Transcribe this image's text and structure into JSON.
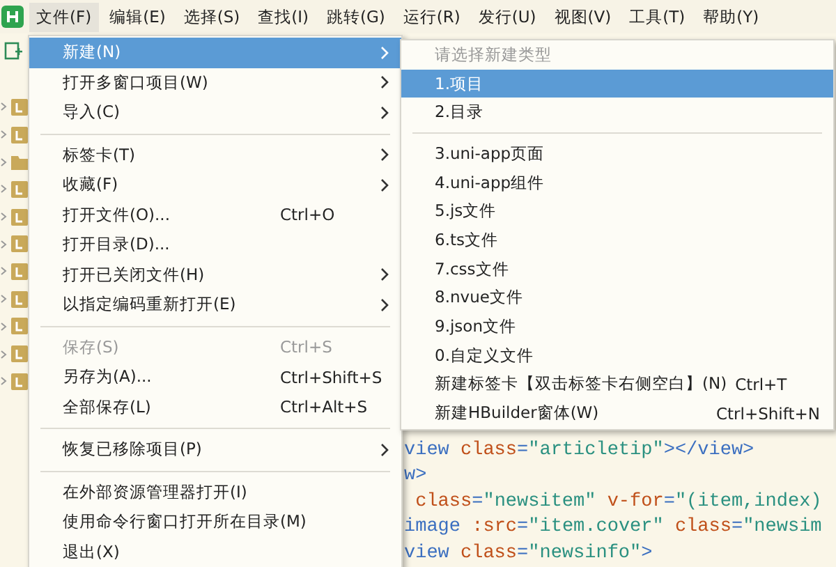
{
  "menubar": {
    "items": [
      {
        "label": "文件(F)",
        "selected": true
      },
      {
        "label": "编辑(E)",
        "selected": false
      },
      {
        "label": "选择(S)",
        "selected": false
      },
      {
        "label": "查找(I)",
        "selected": false
      },
      {
        "label": "跳转(G)",
        "selected": false
      },
      {
        "label": "运行(R)",
        "selected": false
      },
      {
        "label": "发行(U)",
        "selected": false
      },
      {
        "label": "视图(V)",
        "selected": false
      },
      {
        "label": "工具(T)",
        "selected": false
      },
      {
        "label": "帮助(Y)",
        "selected": false
      }
    ]
  },
  "sidebar": {
    "rows": [
      {
        "kind": "project"
      },
      {
        "kind": "project"
      },
      {
        "kind": "folder"
      },
      {
        "kind": "project"
      },
      {
        "kind": "project"
      },
      {
        "kind": "project"
      },
      {
        "kind": "project"
      },
      {
        "kind": "project"
      },
      {
        "kind": "project"
      },
      {
        "kind": "project"
      },
      {
        "kind": "project"
      }
    ]
  },
  "editor": {
    "lines": [
      [
        {
          "kind": "tag",
          "text": "view"
        },
        {
          "kind": "attr",
          "text": " class"
        },
        {
          "kind": "tag",
          "text": "="
        },
        {
          "kind": "string",
          "text": "\"articletip\""
        },
        {
          "kind": "tag",
          "text": "></view>"
        }
      ],
      [
        {
          "kind": "tag",
          "text": "w>"
        }
      ],
      [
        {
          "kind": "attr",
          "text": " class"
        },
        {
          "kind": "tag",
          "text": "="
        },
        {
          "kind": "string",
          "text": "\"newsitem\""
        },
        {
          "kind": "attr",
          "text": " v-for"
        },
        {
          "kind": "tag",
          "text": "="
        },
        {
          "kind": "string",
          "text": "\"(item,index)"
        }
      ],
      [
        {
          "kind": "tag",
          "text": "image"
        },
        {
          "kind": "attr",
          "text": " :src"
        },
        {
          "kind": "tag",
          "text": "="
        },
        {
          "kind": "string",
          "text": "\"item.cover\""
        },
        {
          "kind": "attr",
          "text": " class"
        },
        {
          "kind": "tag",
          "text": "="
        },
        {
          "kind": "string",
          "text": "\"newsim"
        }
      ],
      [
        {
          "kind": "tag",
          "text": "view"
        },
        {
          "kind": "attr",
          "text": " class"
        },
        {
          "kind": "tag",
          "text": "="
        },
        {
          "kind": "string",
          "text": "\"newsinfo\""
        },
        {
          "kind": "tag",
          "text": ">"
        }
      ]
    ]
  },
  "file_menu": {
    "groups": [
      [
        {
          "label": "新建(N)",
          "has_submenu": true,
          "disabled": false,
          "selected": true
        },
        {
          "label": "打开多窗口项目(W)",
          "has_submenu": true,
          "disabled": false,
          "selected": false
        },
        {
          "label": "导入(C)",
          "has_submenu": true,
          "disabled": false,
          "selected": false
        }
      ],
      [
        {
          "label": "标签卡(T)",
          "has_submenu": true,
          "disabled": false,
          "selected": false
        },
        {
          "label": "收藏(F)",
          "has_submenu": true,
          "disabled": false,
          "selected": false
        },
        {
          "label": "打开文件(O)...",
          "shortcut": "Ctrl+O",
          "has_submenu": false,
          "disabled": false,
          "selected": false
        },
        {
          "label": "打开目录(D)...",
          "has_submenu": false,
          "disabled": false,
          "selected": false
        },
        {
          "label": "打开已关闭文件(H)",
          "has_submenu": true,
          "disabled": false,
          "selected": false
        },
        {
          "label": "以指定编码重新打开(E)",
          "has_submenu": true,
          "disabled": false,
          "selected": false
        }
      ],
      [
        {
          "label": "保存(S)",
          "shortcut": "Ctrl+S",
          "has_submenu": false,
          "disabled": true,
          "selected": false
        },
        {
          "label": "另存为(A)...",
          "shortcut": "Ctrl+Shift+S",
          "has_submenu": false,
          "disabled": false,
          "selected": false
        },
        {
          "label": "全部保存(L)",
          "shortcut": "Ctrl+Alt+S",
          "has_submenu": false,
          "disabled": false,
          "selected": false
        }
      ],
      [
        {
          "label": "恢复已移除项目(P)",
          "has_submenu": true,
          "disabled": false,
          "selected": false
        }
      ],
      [
        {
          "label": "在外部资源管理器打开(I)",
          "has_submenu": false,
          "disabled": false,
          "selected": false
        },
        {
          "label": "使用命令行窗口打开所在目录(M)",
          "has_submenu": false,
          "disabled": false,
          "selected": false
        },
        {
          "label": "退出(X)",
          "has_submenu": false,
          "disabled": false,
          "selected": false
        }
      ]
    ]
  },
  "new_submenu": {
    "header": "请选择新建类型",
    "groups": [
      [
        {
          "label": "1.项目",
          "selected": true
        },
        {
          "label": "2.目录",
          "selected": false
        }
      ],
      [
        {
          "label": "3.uni-app页面",
          "selected": false
        },
        {
          "label": "4.uni-app组件",
          "selected": false
        },
        {
          "label": "5.js文件",
          "selected": false
        },
        {
          "label": "6.ts文件",
          "selected": false
        },
        {
          "label": "7.css文件",
          "selected": false
        },
        {
          "label": "8.nvue文件",
          "selected": false
        },
        {
          "label": "9.json文件",
          "selected": false
        },
        {
          "label": "0.自定义文件",
          "selected": false
        },
        {
          "label": "新建标签卡【双击标签卡右侧空白】(N)",
          "shortcut": "Ctrl+T",
          "selected": false
        },
        {
          "label": "新建HBuilder窗体(W)",
          "shortcut": "Ctrl+Shift+N",
          "selected": false
        }
      ]
    ]
  }
}
